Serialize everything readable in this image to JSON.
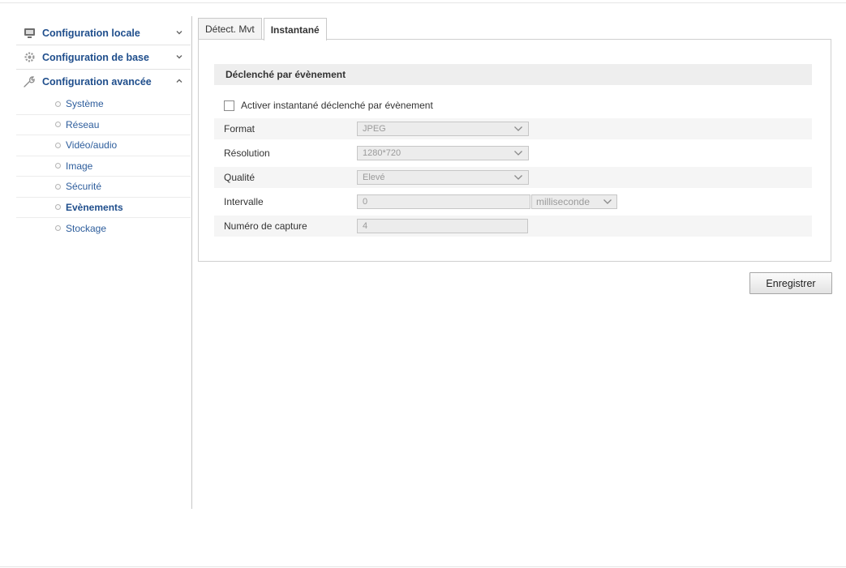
{
  "sidebar": {
    "sections": [
      {
        "label": "Configuration locale",
        "icon": "monitor-icon",
        "expanded": false
      },
      {
        "label": "Configuration de base",
        "icon": "gear-icon",
        "expanded": false
      },
      {
        "label": "Configuration avancée",
        "icon": "wrench-icon",
        "expanded": true
      }
    ],
    "items": [
      {
        "label": "Système"
      },
      {
        "label": "Réseau"
      },
      {
        "label": "Vidéo/audio"
      },
      {
        "label": "Image"
      },
      {
        "label": "Sécurité"
      },
      {
        "label": "Evènements",
        "active": true
      },
      {
        "label": "Stockage"
      }
    ]
  },
  "tabs": [
    {
      "label": "Détect. Mvt",
      "active": false
    },
    {
      "label": "Instantané",
      "active": true
    }
  ],
  "panel": {
    "section_title": "Déclenché par évènement",
    "checkbox_label": "Activer instantané déclenché par évènement",
    "checkbox_checked": false,
    "fields": {
      "format": {
        "label": "Format",
        "value": "JPEG"
      },
      "resolution": {
        "label": "Résolution",
        "value": "1280*720"
      },
      "quality": {
        "label": "Qualité",
        "value": "Elevé"
      },
      "interval": {
        "label": "Intervalle",
        "value": "0",
        "unit": "milliseconde"
      },
      "capture_number": {
        "label": "Numéro de capture",
        "value": "4"
      }
    }
  },
  "actions": {
    "save_label": "Enregistrer"
  },
  "colors": {
    "nav_text": "#1f4e8c",
    "sub_text": "#2d5d9c",
    "section_bar": "#eeeeee"
  }
}
